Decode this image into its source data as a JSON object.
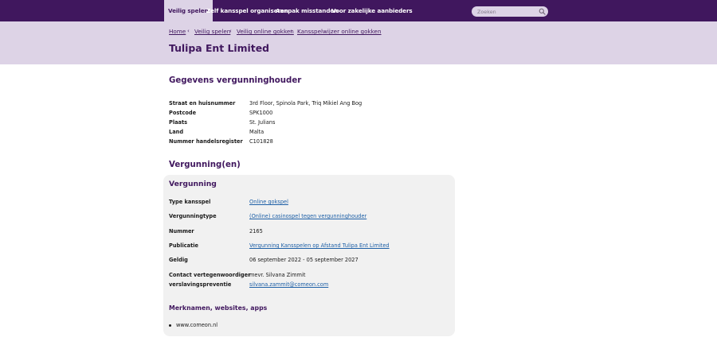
{
  "nav": {
    "items": [
      {
        "label": "Veilig spelen",
        "active": true
      },
      {
        "label": "Zelf kansspel organiseren",
        "active": false
      },
      {
        "label": "Aanpak misstanden",
        "active": false
      },
      {
        "label": "Voor zakelijke aanbieders",
        "active": false
      }
    ],
    "search_placeholder": "Zoeken"
  },
  "breadcrumb": [
    "Home",
    "Veilig spelen",
    "Veilig online gokken",
    "Kansspelwijzer online gokken"
  ],
  "page_title": "Tulipa Ent Limited",
  "holder": {
    "title": "Gegevens vergunninghouder",
    "rows": [
      {
        "label": "Straat en huisnummer",
        "value": "3rd Floor, Spinola Park, Triq Mikiel Ang Bog"
      },
      {
        "label": "Postcode",
        "value": "SPK1000"
      },
      {
        "label": "Plaats",
        "value": "St. Julians"
      },
      {
        "label": "Land",
        "value": "Malta"
      },
      {
        "label": "Nummer handelsregister",
        "value": "C101828"
      }
    ]
  },
  "licenses": {
    "title": "Vergunning(en)",
    "card_title": "Vergunning",
    "type_label": "Type kansspel",
    "type_value": "Online gokspel",
    "vtype_label": "Vergunningtype",
    "vtype_value": "(Online) casinospel tegen vergunninghouder",
    "number_label": "Nummer",
    "number_value": "2165",
    "pub_label": "Publicatie",
    "pub_value": "Vergunning Kansspelen op Afstand Tulipa Ent Limited",
    "valid_label": "Geldig",
    "valid_value": "06 september 2022 - 05 september 2027",
    "contact_label_1": "Contact vertegenwoordiger",
    "contact_label_2": "verslavingspreventie",
    "contact_name": "mevr. Silvana Zimmit",
    "contact_email": "silvana.zammit@comeon.com",
    "brands_title": "Merknamen, websites, apps",
    "brands": [
      "www.comeon.nl"
    ]
  },
  "colors": {
    "brand": "#40175e",
    "hero": "#ddd3e6",
    "card": "#f1f1f1",
    "link": "#1d5fa6"
  }
}
